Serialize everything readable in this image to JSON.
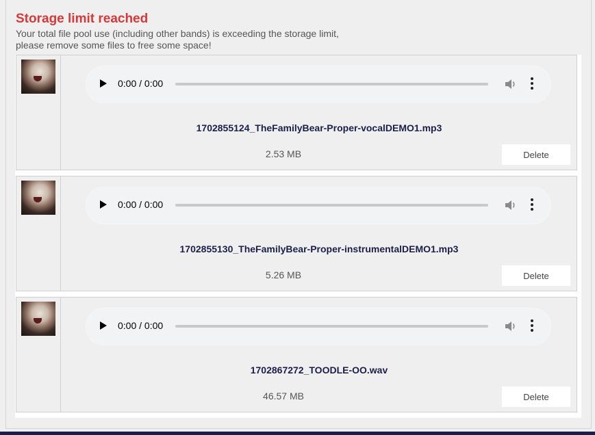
{
  "warning": {
    "title": "Storage limit reached",
    "line1": "Your total file pool use (including other bands) is exceeding the storage limit,",
    "line2": "please remove some files to free some space!"
  },
  "files": [
    {
      "time": "0:00 / 0:00",
      "filename": "1702855124_TheFamilyBear-Proper-vocalDEMO1.mp3",
      "size": "2.53 MB",
      "delete_label": "Delete"
    },
    {
      "time": "0:00 / 0:00",
      "filename": "1702855130_TheFamilyBear-Proper-instrumentalDEMO1.mp3",
      "size": "5.26 MB",
      "delete_label": "Delete"
    },
    {
      "time": "0:00 / 0:00",
      "filename": "1702867272_TOODLE-OO.wav",
      "size": "46.57 MB",
      "delete_label": "Delete"
    }
  ],
  "colors": {
    "title": "#d6393a",
    "filename": "#1a1f4a",
    "footer_bar": "#1a1f4a"
  },
  "icons": {
    "play": "play-icon",
    "volume": "volume-icon",
    "more": "more-options-icon",
    "avatar": "user-avatar"
  }
}
